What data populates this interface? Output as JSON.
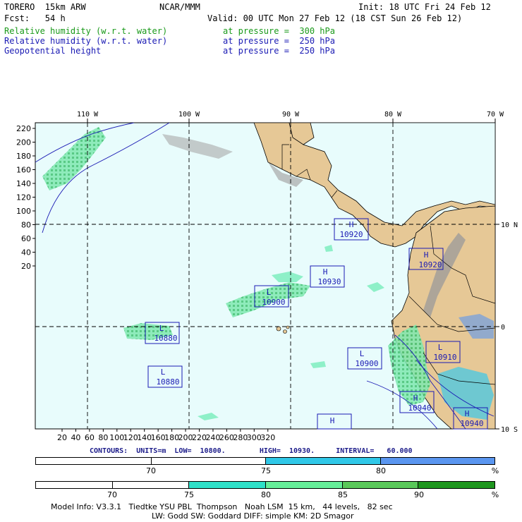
{
  "header": {
    "model": "TORERO  15km ARW",
    "org": "NCAR/MMM",
    "init": "Init: 18 UTC Fri 24 Feb 12",
    "fcst": "Fcst:   54 h",
    "valid": "Valid: 00 UTC Mon 27 Feb 12 (18 CST Sun 26 Feb 12)",
    "fields": [
      {
        "name": "Relative humidity (w.r.t. water)",
        "level": "at pressure =  300 hPa",
        "color": "#1a9a1a"
      },
      {
        "name": "Relative humidity (w.r.t. water)",
        "level": "at pressure =  250 hPa",
        "color": "#1a1ab4"
      },
      {
        "name": "Geopotential height",
        "level": "at pressure =  250 hPa",
        "color": "#1a1ab4"
      }
    ]
  },
  "map": {
    "lon_labels": [
      "110 W",
      "100 W",
      "90 W",
      "80 W",
      "70 W"
    ],
    "lat_labels": [
      "10 N",
      "0",
      "10 S"
    ],
    "y_ticks": [
      "220",
      "200",
      "180",
      "160",
      "140",
      "120",
      "100",
      "80",
      "60",
      "40",
      "20"
    ],
    "x_ticks": [
      "20",
      "40",
      "60",
      "80",
      "100",
      "120",
      "140",
      "160",
      "180",
      "200",
      "220",
      "240",
      "260",
      "280",
      "300",
      "320"
    ],
    "centers": [
      {
        "type": "H",
        "value": "10920"
      },
      {
        "type": "H",
        "value": "10920"
      },
      {
        "type": "H",
        "value": "10930"
      },
      {
        "type": "L",
        "value": "10900"
      },
      {
        "type": "L",
        "value": "10880"
      },
      {
        "type": "L",
        "value": "10880"
      },
      {
        "type": "L",
        "value": "10900"
      },
      {
        "type": "L",
        "value": "10910"
      },
      {
        "type": "H",
        "value": "10940"
      },
      {
        "type": "H",
        "value": "10940"
      },
      {
        "type": "H",
        "value": ""
      }
    ],
    "colors": {
      "ocean": "#e8fcfc",
      "land": "#e6c896",
      "mountain": "#a8a8a8"
    }
  },
  "contours": {
    "text": "CONTOURS:  UNITS=m  LOW=  10800.        HIGH=  10930.     INTERVAL=   60.000"
  },
  "colorbar1": {
    "labels": [
      "70",
      "75",
      "80",
      "%"
    ],
    "colors": [
      "#ffffff",
      "#ffffff",
      "#30c8e8",
      "#5a96f0"
    ]
  },
  "colorbar2": {
    "labels": [
      "70",
      "75",
      "80",
      "85",
      "90",
      "%"
    ],
    "colors": [
      "#ffffff",
      "#ffffff",
      "#ffffff",
      "#2ee0c8",
      "#66ee99",
      "#5ac85a",
      "#1e961e"
    ]
  },
  "footer": {
    "line1": "Model Info: V3.3.1   Tiedtke YSU PBL  Thompson   Noah LSM  15 km,   44 levels,   82 sec",
    "line2": "LW: Godd SW: Goddard DIFF: simple KM: 2D Smagor"
  }
}
